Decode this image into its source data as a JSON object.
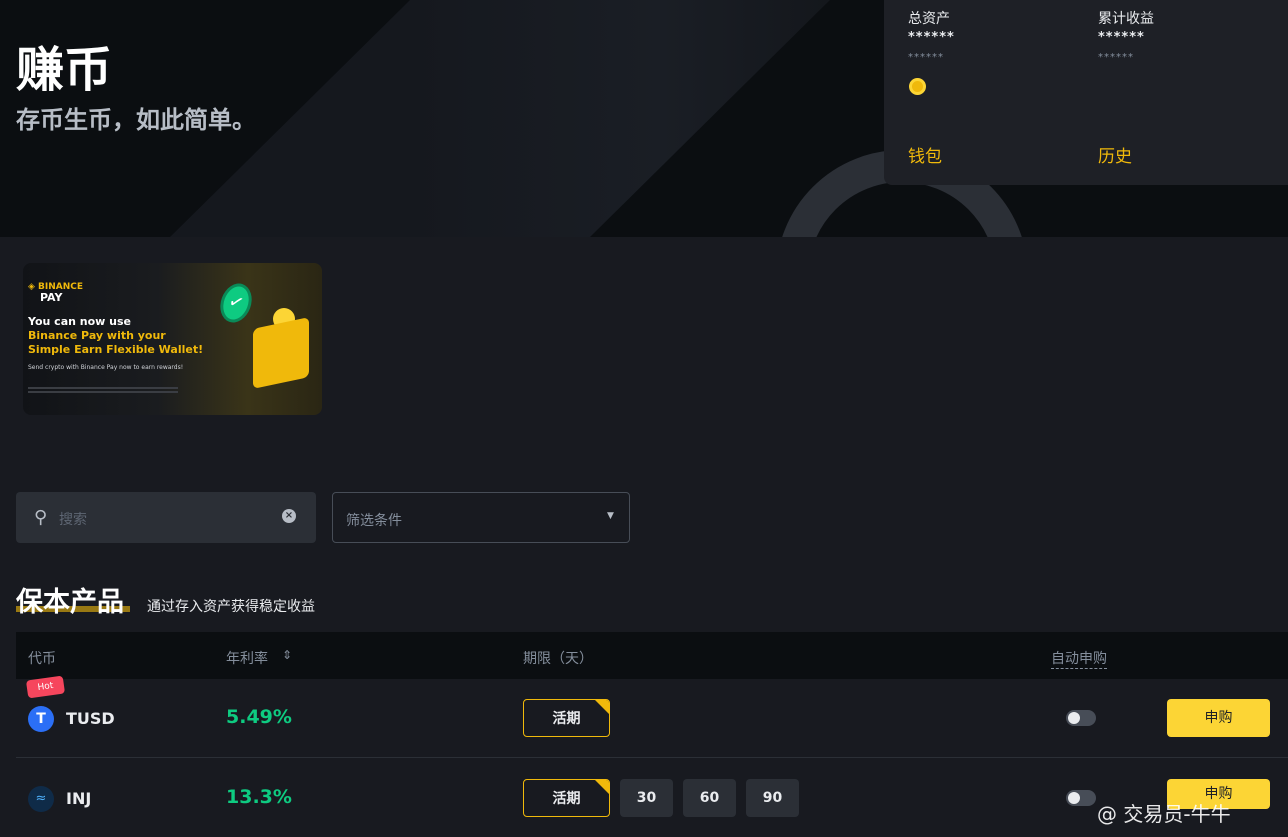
{
  "hero": {
    "title": "赚币",
    "subtitle": "存币生币，如此简单。"
  },
  "assets": {
    "total_label": "总资产",
    "total_value": "******",
    "total_sub": "******",
    "earn_label": "累计收益",
    "earn_value": "******",
    "earn_sub": "******",
    "wallet_link": "钱包",
    "history_link": "历史"
  },
  "banner": {
    "brand_top": "◈ BINANCE",
    "brand_bottom": "PAY",
    "line1": "You can now use",
    "line2": "Binance Pay with your",
    "line3": "Simple Earn Flexible Wallet!",
    "line4": "Send crypto with Binance Pay now to earn rewards!"
  },
  "search": {
    "placeholder": "搜索",
    "icon": "search-icon"
  },
  "filter": {
    "placeholder": "筛选条件"
  },
  "section": {
    "title": "保本产品",
    "subtitle": "通过存入资产获得稳定收益"
  },
  "table": {
    "headers": {
      "coin": "代币",
      "apr": "年利率",
      "term": "期限（天）",
      "auto": "自动申购"
    },
    "rows": [
      {
        "symbol": "TUSD",
        "apr": "5.49%",
        "badge": "Hot",
        "flex_label": "活期",
        "terms": [],
        "buy_label": "申购",
        "coin_color": "#2b6ff6"
      },
      {
        "symbol": "INJ",
        "apr": "13.3%",
        "flex_label": "活期",
        "terms": [
          "30",
          "60",
          "90"
        ],
        "buy_label": "申购",
        "coin_color": "#0f2b48"
      }
    ]
  },
  "watermark": "@ 交易员-牛牛",
  "colors": {
    "accent": "#f0b90b",
    "positive": "#0ecb81",
    "hot": "#f6465d"
  }
}
